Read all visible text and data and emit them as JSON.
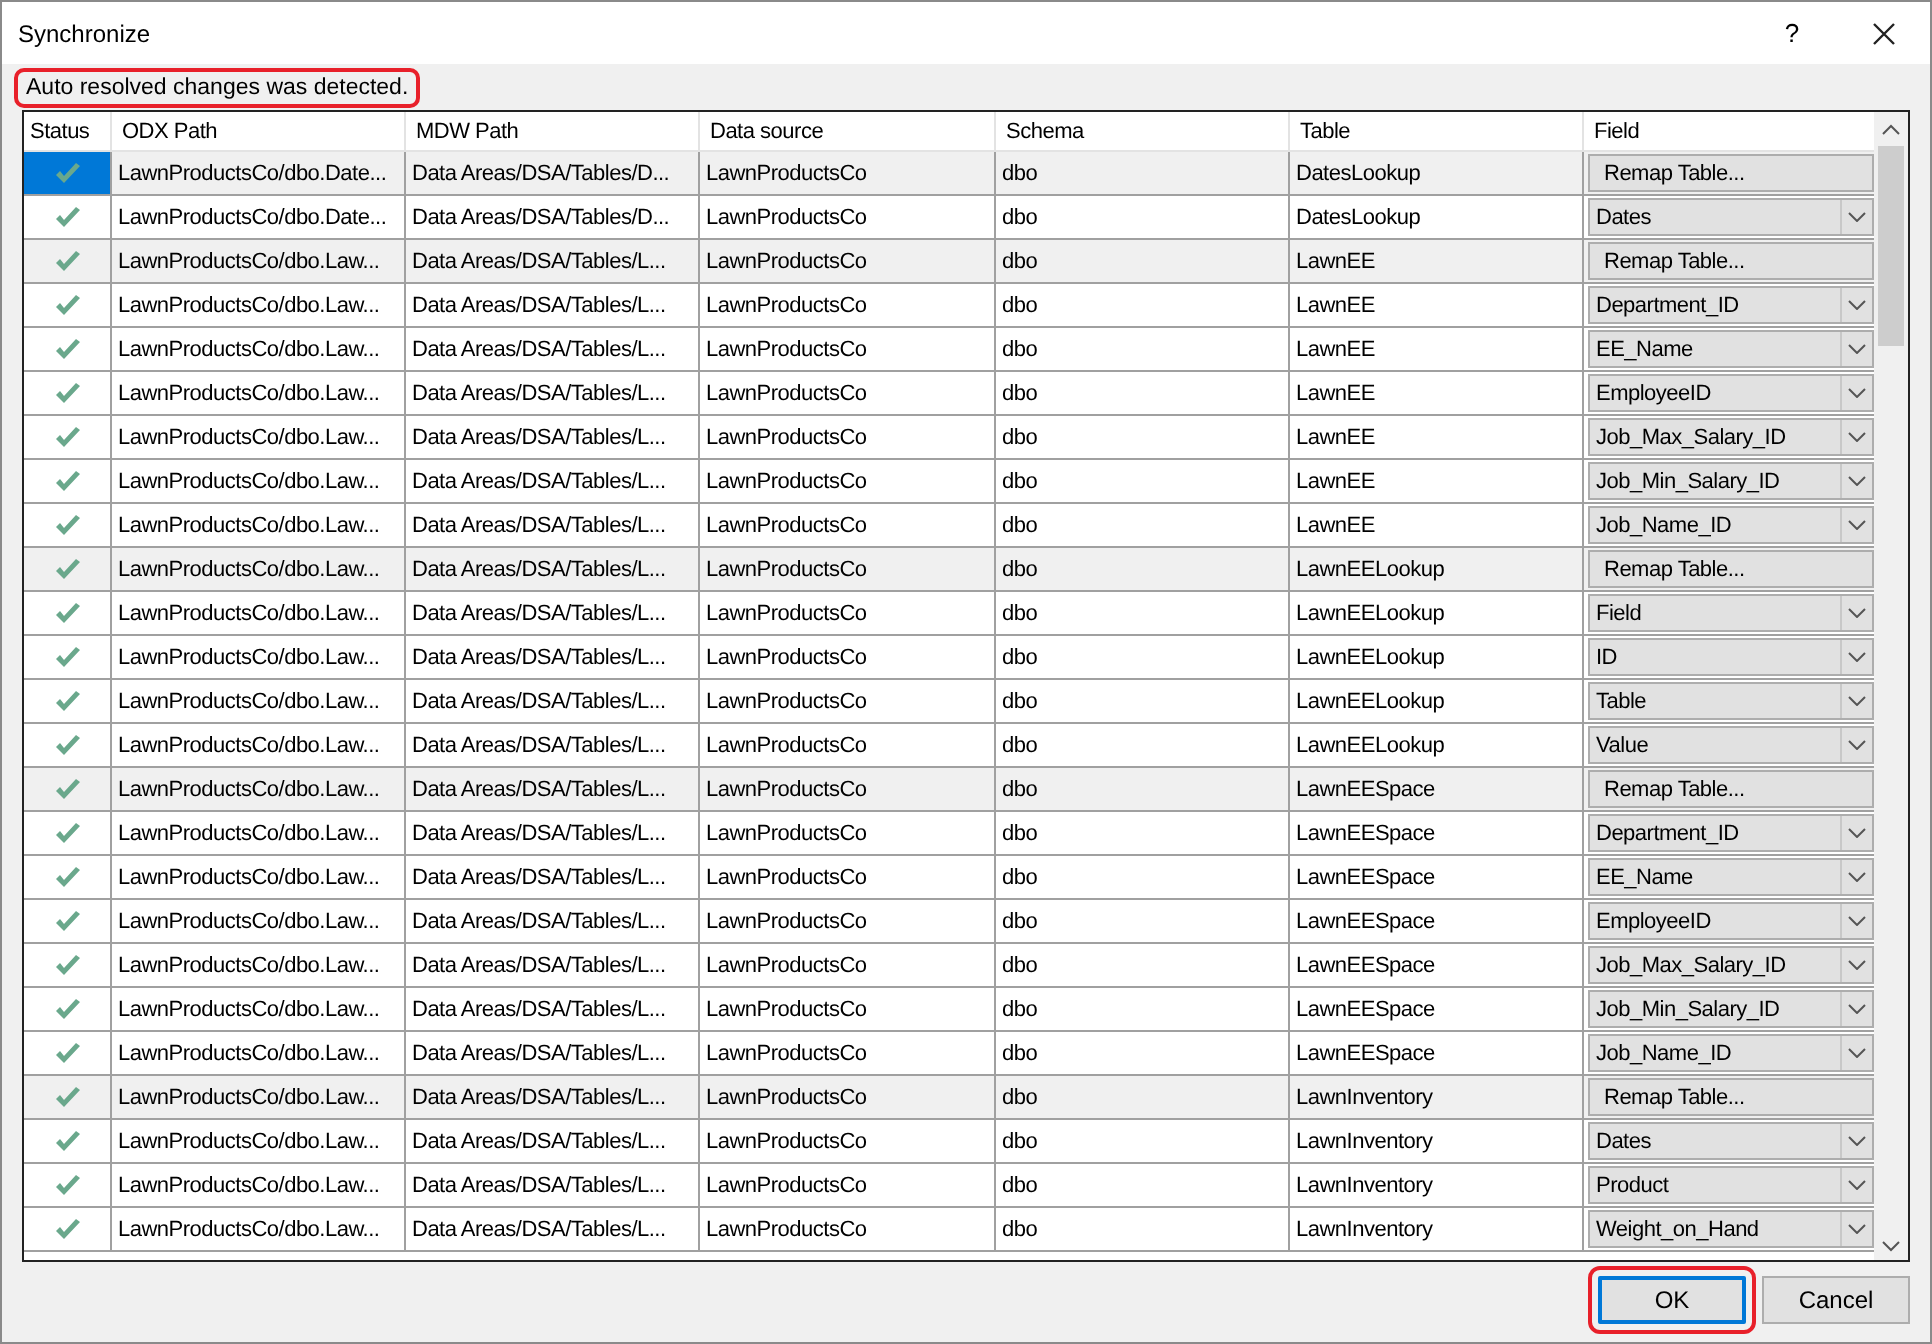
{
  "window": {
    "title": "Synchronize",
    "help": "?"
  },
  "message": {
    "text": "Auto resolved changes was detected.",
    "highlighted": true
  },
  "table": {
    "columns": [
      "Status",
      "ODX Path",
      "MDW Path",
      "Data source",
      "Schema",
      "Table",
      "Field"
    ],
    "rows": [
      {
        "kind": "remap",
        "selected": true,
        "odx": "LawnProductsCo/dbo.Date...",
        "mdw": "Data Areas/DSA/Tables/D...",
        "source": "LawnProductsCo",
        "schema": "dbo",
        "table": "DatesLookup",
        "field": "Remap Table..."
      },
      {
        "kind": "field",
        "selected": false,
        "odx": "LawnProductsCo/dbo.Date...",
        "mdw": "Data Areas/DSA/Tables/D...",
        "source": "LawnProductsCo",
        "schema": "dbo",
        "table": "DatesLookup",
        "field": "Dates"
      },
      {
        "kind": "remap",
        "selected": false,
        "odx": "LawnProductsCo/dbo.Law...",
        "mdw": "Data Areas/DSA/Tables/L...",
        "source": "LawnProductsCo",
        "schema": "dbo",
        "table": "LawnEE",
        "field": "Remap Table..."
      },
      {
        "kind": "field",
        "selected": false,
        "odx": "LawnProductsCo/dbo.Law...",
        "mdw": "Data Areas/DSA/Tables/L...",
        "source": "LawnProductsCo",
        "schema": "dbo",
        "table": "LawnEE",
        "field": "Department_ID"
      },
      {
        "kind": "field",
        "selected": false,
        "odx": "LawnProductsCo/dbo.Law...",
        "mdw": "Data Areas/DSA/Tables/L...",
        "source": "LawnProductsCo",
        "schema": "dbo",
        "table": "LawnEE",
        "field": "EE_Name"
      },
      {
        "kind": "field",
        "selected": false,
        "odx": "LawnProductsCo/dbo.Law...",
        "mdw": "Data Areas/DSA/Tables/L...",
        "source": "LawnProductsCo",
        "schema": "dbo",
        "table": "LawnEE",
        "field": "EmployeeID"
      },
      {
        "kind": "field",
        "selected": false,
        "odx": "LawnProductsCo/dbo.Law...",
        "mdw": "Data Areas/DSA/Tables/L...",
        "source": "LawnProductsCo",
        "schema": "dbo",
        "table": "LawnEE",
        "field": "Job_Max_Salary_ID"
      },
      {
        "kind": "field",
        "selected": false,
        "odx": "LawnProductsCo/dbo.Law...",
        "mdw": "Data Areas/DSA/Tables/L...",
        "source": "LawnProductsCo",
        "schema": "dbo",
        "table": "LawnEE",
        "field": "Job_Min_Salary_ID"
      },
      {
        "kind": "field",
        "selected": false,
        "odx": "LawnProductsCo/dbo.Law...",
        "mdw": "Data Areas/DSA/Tables/L...",
        "source": "LawnProductsCo",
        "schema": "dbo",
        "table": "LawnEE",
        "field": "Job_Name_ID"
      },
      {
        "kind": "remap",
        "selected": false,
        "odx": "LawnProductsCo/dbo.Law...",
        "mdw": "Data Areas/DSA/Tables/L...",
        "source": "LawnProductsCo",
        "schema": "dbo",
        "table": "LawnEELookup",
        "field": "Remap Table..."
      },
      {
        "kind": "field",
        "selected": false,
        "odx": "LawnProductsCo/dbo.Law...",
        "mdw": "Data Areas/DSA/Tables/L...",
        "source": "LawnProductsCo",
        "schema": "dbo",
        "table": "LawnEELookup",
        "field": "Field"
      },
      {
        "kind": "field",
        "selected": false,
        "odx": "LawnProductsCo/dbo.Law...",
        "mdw": "Data Areas/DSA/Tables/L...",
        "source": "LawnProductsCo",
        "schema": "dbo",
        "table": "LawnEELookup",
        "field": "ID"
      },
      {
        "kind": "field",
        "selected": false,
        "odx": "LawnProductsCo/dbo.Law...",
        "mdw": "Data Areas/DSA/Tables/L...",
        "source": "LawnProductsCo",
        "schema": "dbo",
        "table": "LawnEELookup",
        "field": "Table"
      },
      {
        "kind": "field",
        "selected": false,
        "odx": "LawnProductsCo/dbo.Law...",
        "mdw": "Data Areas/DSA/Tables/L...",
        "source": "LawnProductsCo",
        "schema": "dbo",
        "table": "LawnEELookup",
        "field": "Value"
      },
      {
        "kind": "remap",
        "selected": false,
        "odx": "LawnProductsCo/dbo.Law...",
        "mdw": "Data Areas/DSA/Tables/L...",
        "source": "LawnProductsCo",
        "schema": "dbo",
        "table": "LawnEESpace",
        "field": "Remap Table..."
      },
      {
        "kind": "field",
        "selected": false,
        "odx": "LawnProductsCo/dbo.Law...",
        "mdw": "Data Areas/DSA/Tables/L...",
        "source": "LawnProductsCo",
        "schema": "dbo",
        "table": "LawnEESpace",
        "field": "Department_ID"
      },
      {
        "kind": "field",
        "selected": false,
        "odx": "LawnProductsCo/dbo.Law...",
        "mdw": "Data Areas/DSA/Tables/L...",
        "source": "LawnProductsCo",
        "schema": "dbo",
        "table": "LawnEESpace",
        "field": "EE_Name"
      },
      {
        "kind": "field",
        "selected": false,
        "odx": "LawnProductsCo/dbo.Law...",
        "mdw": "Data Areas/DSA/Tables/L...",
        "source": "LawnProductsCo",
        "schema": "dbo",
        "table": "LawnEESpace",
        "field": "EmployeeID"
      },
      {
        "kind": "field",
        "selected": false,
        "odx": "LawnProductsCo/dbo.Law...",
        "mdw": "Data Areas/DSA/Tables/L...",
        "source": "LawnProductsCo",
        "schema": "dbo",
        "table": "LawnEESpace",
        "field": "Job_Max_Salary_ID"
      },
      {
        "kind": "field",
        "selected": false,
        "odx": "LawnProductsCo/dbo.Law...",
        "mdw": "Data Areas/DSA/Tables/L...",
        "source": "LawnProductsCo",
        "schema": "dbo",
        "table": "LawnEESpace",
        "field": "Job_Min_Salary_ID"
      },
      {
        "kind": "field",
        "selected": false,
        "odx": "LawnProductsCo/dbo.Law...",
        "mdw": "Data Areas/DSA/Tables/L...",
        "source": "LawnProductsCo",
        "schema": "dbo",
        "table": "LawnEESpace",
        "field": "Job_Name_ID"
      },
      {
        "kind": "remap",
        "selected": false,
        "odx": "LawnProductsCo/dbo.Law...",
        "mdw": "Data Areas/DSA/Tables/L...",
        "source": "LawnProductsCo",
        "schema": "dbo",
        "table": "LawnInventory",
        "field": "Remap Table..."
      },
      {
        "kind": "field",
        "selected": false,
        "odx": "LawnProductsCo/dbo.Law...",
        "mdw": "Data Areas/DSA/Tables/L...",
        "source": "LawnProductsCo",
        "schema": "dbo",
        "table": "LawnInventory",
        "field": "Dates"
      },
      {
        "kind": "field",
        "selected": false,
        "odx": "LawnProductsCo/dbo.Law...",
        "mdw": "Data Areas/DSA/Tables/L...",
        "source": "LawnProductsCo",
        "schema": "dbo",
        "table": "LawnInventory",
        "field": "Product"
      },
      {
        "kind": "field",
        "selected": false,
        "odx": "LawnProductsCo/dbo.Law...",
        "mdw": "Data Areas/DSA/Tables/L...",
        "source": "LawnProductsCo",
        "schema": "dbo",
        "table": "LawnInventory",
        "field": "Weight_on_Hand"
      }
    ]
  },
  "buttons": [
    {
      "label": "OK",
      "highlighted": true
    },
    {
      "label": "Cancel",
      "highlighted": false
    }
  ]
}
